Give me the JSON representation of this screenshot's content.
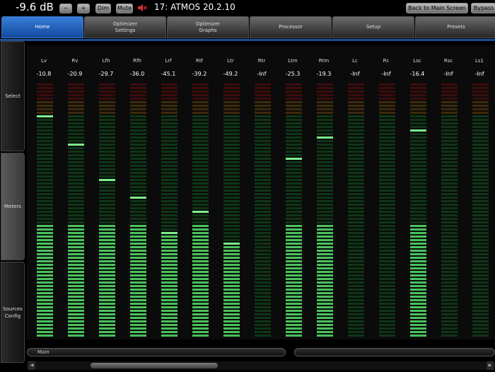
{
  "topbar": {
    "volume": "-9.6 dB",
    "vol_down_label": "−",
    "vol_up_label": "+",
    "dim_label": "Dim",
    "mute_label": "Mute",
    "preset_name": "17: ATMOS 20.2.10",
    "back_label": "Back to Main Screen",
    "bypass_label": "Bypass"
  },
  "tabs": [
    {
      "label": "Home"
    },
    {
      "label": "Optimizer\nSettings"
    },
    {
      "label": "Optimizer\nGraphs"
    },
    {
      "label": "Processor"
    },
    {
      "label": "Setup"
    },
    {
      "label": "Presets"
    }
  ],
  "sidebar": [
    {
      "label": "Select"
    },
    {
      "label": "Meters"
    },
    {
      "label": "Sources\nConfig"
    }
  ],
  "meters": [
    {
      "name": "Lv",
      "value": "-10.8",
      "level": 0.87
    },
    {
      "name": "Rv",
      "value": "-20.9",
      "level": 0.76
    },
    {
      "name": "Lfh",
      "value": "-29.7",
      "level": 0.63
    },
    {
      "name": "Rfh",
      "value": "-36.0",
      "level": 0.56
    },
    {
      "name": "Lrf",
      "value": "-45.1",
      "level": 0.41
    },
    {
      "name": "Rtf",
      "value": "-39.2",
      "level": 0.5
    },
    {
      "name": "Ltr",
      "value": "-49.2",
      "level": 0.37
    },
    {
      "name": "Rtr",
      "value": "-Inf",
      "level": 0
    },
    {
      "name": "Ltm",
      "value": "-25.3",
      "level": 0.71
    },
    {
      "name": "Rtm",
      "value": "-19.3",
      "level": 0.79
    },
    {
      "name": "Lc",
      "value": "-Inf",
      "level": 0
    },
    {
      "name": "Rc",
      "value": "-Inf",
      "level": 0
    },
    {
      "name": "Lsc",
      "value": "-16.4",
      "level": 0.82
    },
    {
      "name": "Rsc",
      "value": "-Inf",
      "level": 0
    },
    {
      "name": "Ls1",
      "value": "-Inf",
      "level": 0
    }
  ],
  "bottom": {
    "left_label": "Main",
    "right_label": ""
  },
  "colors": {
    "accent": "#1b5fc6",
    "meter_off_green": "#0f3616",
    "meter_on_green": "#49c25c",
    "meter_off_red": "#3d0c0c",
    "meter_off_orange": "#3d2a0a"
  }
}
